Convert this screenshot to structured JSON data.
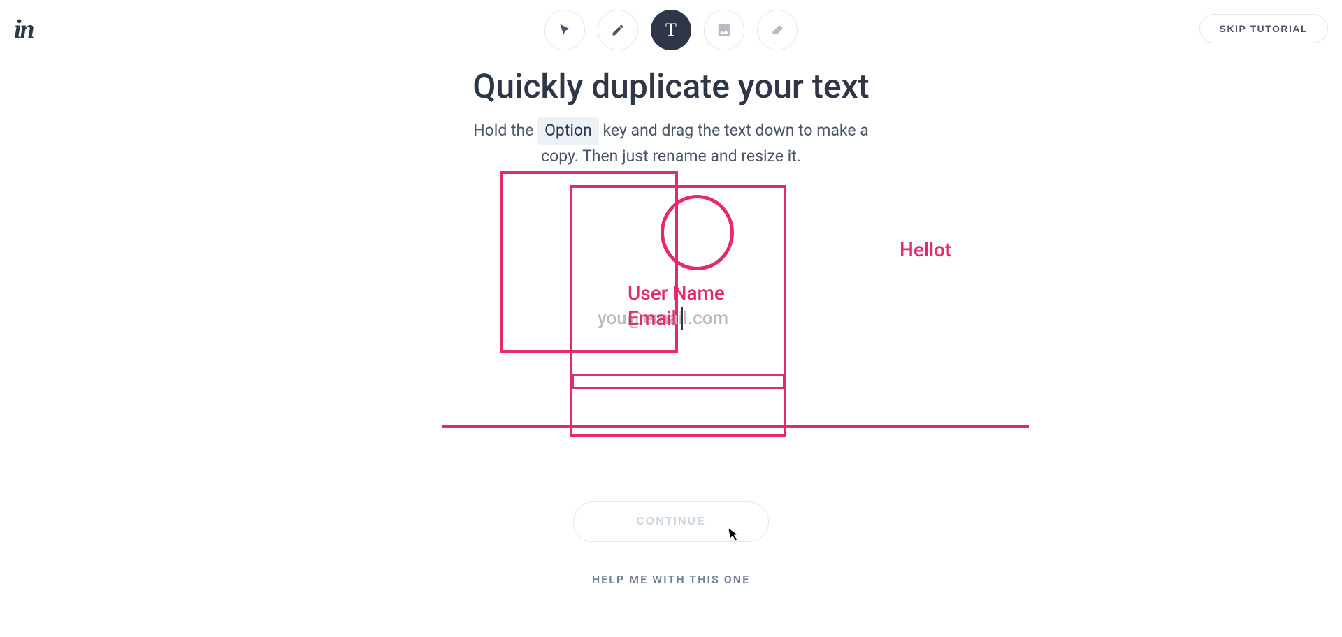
{
  "logo": "in",
  "skip_label": "SKIP TUTORIAL",
  "toolbar": {
    "tools": [
      {
        "name": "pointer",
        "active": false
      },
      {
        "name": "pencil",
        "active": false
      },
      {
        "name": "text",
        "active": true,
        "glyph": "T"
      },
      {
        "name": "image",
        "active": false
      },
      {
        "name": "eraser",
        "active": false
      }
    ]
  },
  "heading": "Quickly duplicate your text",
  "instruction": {
    "pre": "Hold the ",
    "key": "Option",
    "post": " key and drag the text down to make a copy. Then just rename and resize it."
  },
  "canvas": {
    "username_text": "User Name",
    "email_overlay_text": "Email",
    "email_background_text": "you@email.com",
    "side_text": "Hellot"
  },
  "continue_label": "CONTINUE",
  "help_label": "HELP ME WITH THIS ONE"
}
